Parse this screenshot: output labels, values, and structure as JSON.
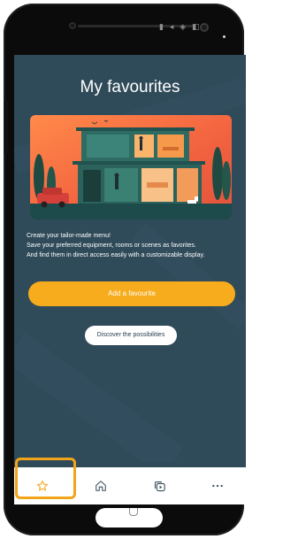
{
  "header": {
    "title": "My favourites"
  },
  "status_bar": {
    "glyphs": "▮ ◂ ◈ ◧"
  },
  "description": {
    "line1": "Create your tailor-made menu!",
    "line2": "Save your preferred equipment, rooms or scenes as favorites.",
    "line3": "And find them in direct access easily with a customizable display."
  },
  "actions": {
    "add_favourite": "Add a favourite",
    "discover": "Discover the possibilities"
  },
  "bottom_nav": {
    "items": [
      {
        "name": "favourites",
        "icon": "star-icon",
        "active": true
      },
      {
        "name": "home",
        "icon": "home-icon"
      },
      {
        "name": "scenes",
        "icon": "play-scenes-icon"
      },
      {
        "name": "more",
        "icon": "more-dots-icon"
      }
    ]
  },
  "colors": {
    "screen_bg": "#2f4a59",
    "accent": "#f6ac1c",
    "highlight": "#f2a51a",
    "nav_icon": "#3a4f5c"
  }
}
